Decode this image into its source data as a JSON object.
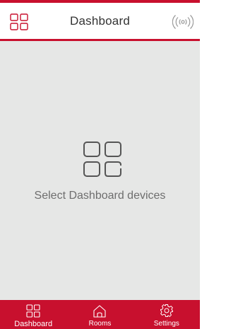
{
  "header": {
    "title": "Dashboard",
    "left_icon": "grid-menu-icon",
    "right_icon": "wireless-signal-icon"
  },
  "main": {
    "empty_icon": "dashboard-grid-icon",
    "empty_message": "Select Dashboard devices"
  },
  "tabs": [
    {
      "label": "Dashboard",
      "icon": "dashboard-grid-icon",
      "active": true
    },
    {
      "label": "Rooms",
      "icon": "house-icon",
      "active": false
    },
    {
      "label": "Settings",
      "icon": "gear-icon",
      "active": false
    }
  ],
  "colors": {
    "accent": "#c8102e",
    "background": "#e6e7e6",
    "text_muted": "#6e6e6e"
  }
}
